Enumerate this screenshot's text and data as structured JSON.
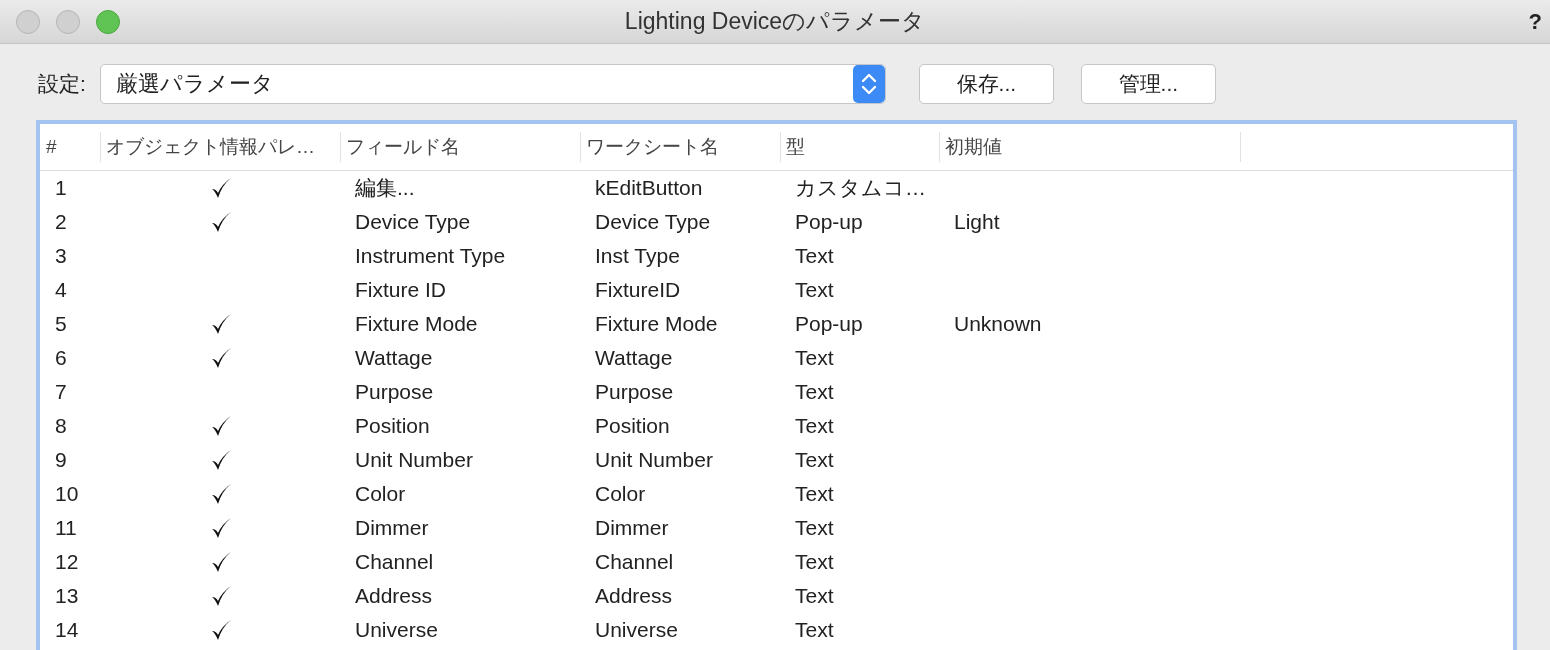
{
  "window": {
    "title": "Lighting Deviceのパラメータ",
    "help": "?"
  },
  "settings": {
    "label": "設定:",
    "value": "厳選パラメータ"
  },
  "buttons": [
    "保存...",
    "管理..."
  ],
  "table": {
    "columns": [
      "#",
      "オブジェクト情報パレ…",
      "フィールド名",
      "ワークシート名",
      "型",
      "初期値"
    ],
    "rows": [
      {
        "number": "1",
        "checked": true,
        "field": "編集...",
        "worksheet": "kEditButton",
        "type": "カスタムコ…",
        "default": ""
      },
      {
        "number": "2",
        "checked": true,
        "field": "Device Type",
        "worksheet": "Device Type",
        "type": "Pop-up",
        "default": "Light"
      },
      {
        "number": "3",
        "checked": false,
        "field": "Instrument Type",
        "worksheet": "Inst Type",
        "type": "Text",
        "default": ""
      },
      {
        "number": "4",
        "checked": false,
        "field": "Fixture ID",
        "worksheet": "FixtureID",
        "type": "Text",
        "default": ""
      },
      {
        "number": "5",
        "checked": true,
        "field": "Fixture Mode",
        "worksheet": "Fixture Mode",
        "type": "Pop-up",
        "default": "Unknown"
      },
      {
        "number": "6",
        "checked": true,
        "field": "Wattage",
        "worksheet": "Wattage",
        "type": "Text",
        "default": ""
      },
      {
        "number": "7",
        "checked": false,
        "field": "Purpose",
        "worksheet": "Purpose",
        "type": "Text",
        "default": ""
      },
      {
        "number": "8",
        "checked": true,
        "field": "Position",
        "worksheet": "Position",
        "type": "Text",
        "default": ""
      },
      {
        "number": "9",
        "checked": true,
        "field": "Unit Number",
        "worksheet": "Unit Number",
        "type": "Text",
        "default": ""
      },
      {
        "number": "10",
        "checked": true,
        "field": "Color",
        "worksheet": "Color",
        "type": "Text",
        "default": ""
      },
      {
        "number": "11",
        "checked": true,
        "field": "Dimmer",
        "worksheet": "Dimmer",
        "type": "Text",
        "default": ""
      },
      {
        "number": "12",
        "checked": true,
        "field": "Channel",
        "worksheet": "Channel",
        "type": "Text",
        "default": ""
      },
      {
        "number": "13",
        "checked": true,
        "field": "Address",
        "worksheet": "Address",
        "type": "Text",
        "default": ""
      },
      {
        "number": "14",
        "checked": true,
        "field": "Universe",
        "worksheet": "Universe",
        "type": "Text",
        "default": ""
      }
    ]
  }
}
